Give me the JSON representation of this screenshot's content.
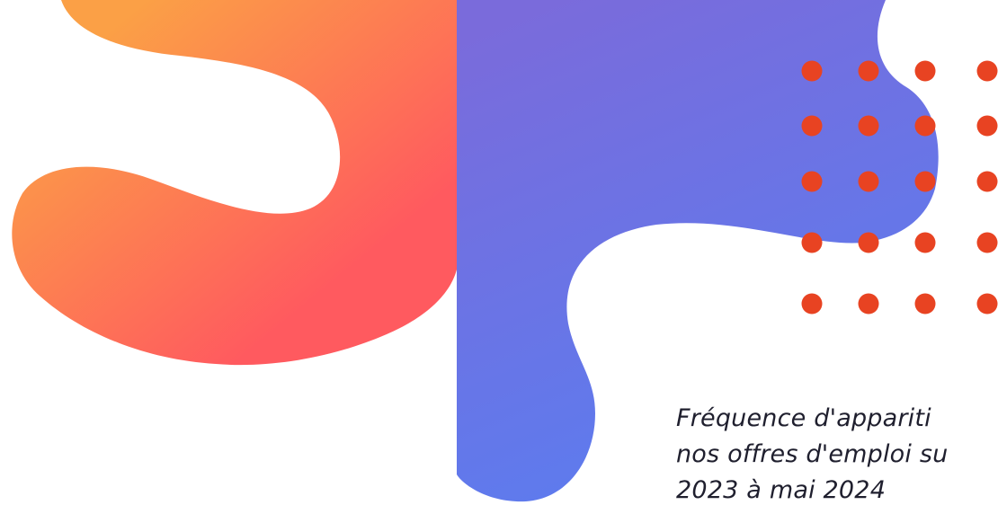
{
  "colors": {
    "orange_light": "#FBA046",
    "orange_red": "#FF5A5F",
    "blue_purple": "#7A6BDB",
    "blue": "#5A7DF0",
    "dot": "#E84322",
    "text": "#1F1F2E"
  },
  "caption": {
    "lines": [
      "Fréquence d'appariti",
      "nos offres d'emploi su",
      "2023 à mai 2024"
    ]
  }
}
